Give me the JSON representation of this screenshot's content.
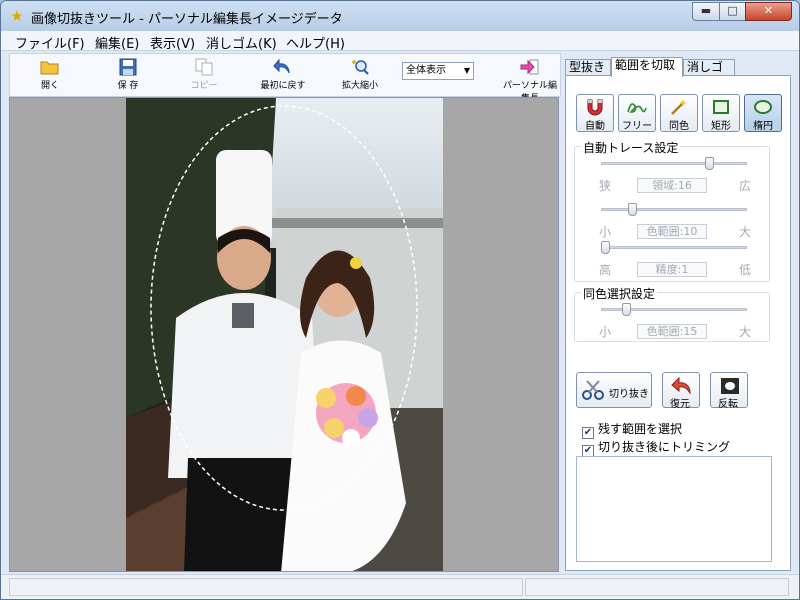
{
  "window": {
    "title": "画像切抜きツール - パーソナル編集長イメージデータ"
  },
  "window_controls": {
    "minimize": "▬",
    "maximize": "□",
    "close": "✕"
  },
  "menu": [
    {
      "label": "ファイル(F)"
    },
    {
      "label": "編集(E)"
    },
    {
      "label": "表示(V)"
    },
    {
      "label": "消しゴム(K)"
    },
    {
      "label": "ヘルプ(H)"
    }
  ],
  "toolbar": {
    "open": "開く",
    "save": "保 存",
    "copy": "コピー",
    "revert": "最初に戻す",
    "zoom": "拡大縮小",
    "zoom_select": "全体表示",
    "personal": "パーソナル編集長"
  },
  "tabs": [
    {
      "label": "型抜き"
    },
    {
      "label": "範囲を切取"
    },
    {
      "label": "消しゴム"
    }
  ],
  "modes": [
    {
      "label": "自動"
    },
    {
      "label": "フリー"
    },
    {
      "label": "同色"
    },
    {
      "label": "矩形"
    },
    {
      "label": "楕円"
    }
  ],
  "auto_trace": {
    "title": "自動トレース設定",
    "slider1": {
      "left": "狭",
      "right": "広",
      "value": "領域:16",
      "position": 0.76
    },
    "slider2": {
      "left": "小",
      "right": "大",
      "value": "色範囲:10",
      "position": 0.2
    },
    "slider3": {
      "left": "高",
      "right": "低",
      "value": "精度:1",
      "position": 0.0
    }
  },
  "same_color": {
    "title": "同色選択設定",
    "slider1": {
      "left": "小",
      "right": "大",
      "value": "色範囲:15",
      "position": 0.15
    }
  },
  "actions": {
    "cut": "切り抜き",
    "restore": "復元",
    "invert": "反転"
  },
  "options": {
    "keep_selection": "残す範囲を選択",
    "trim_after": "切り抜き後にトリミング"
  },
  "colors": {
    "accent": "#3c78c8",
    "titlebar": "#c4d7ee",
    "selected": "#b7cfe9"
  }
}
